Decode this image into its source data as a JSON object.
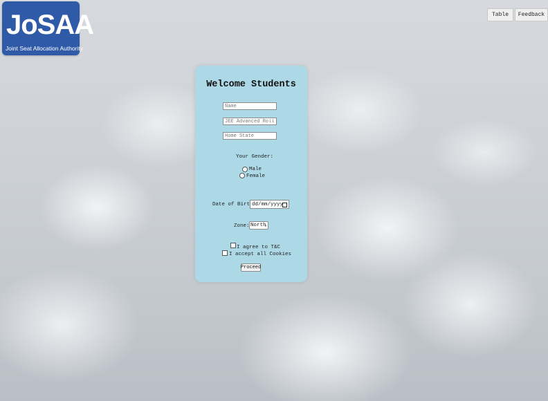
{
  "logo": {
    "mark": "JoSAA",
    "subtitle": "Joint Seat Allocation Authority"
  },
  "nav": {
    "table_label": "Table",
    "feedback_label": "Feedback"
  },
  "form": {
    "title": "Welcome Students",
    "name_placeholder": "Name",
    "roll_placeholder": "JEE Advanced Roll No.",
    "state_placeholder": "Home State",
    "gender_label": "Your Gender:",
    "gender_options": [
      "Male",
      "Female"
    ],
    "dob_label": "Date of Birth:",
    "dob_placeholder": "dd/mm/yyyy",
    "zone_label": "Zone:",
    "zone_selected": "North",
    "terms_label": "I agree to T&C",
    "cookies_label": "I accept all Cookies",
    "proceed_label": "Proceed"
  }
}
